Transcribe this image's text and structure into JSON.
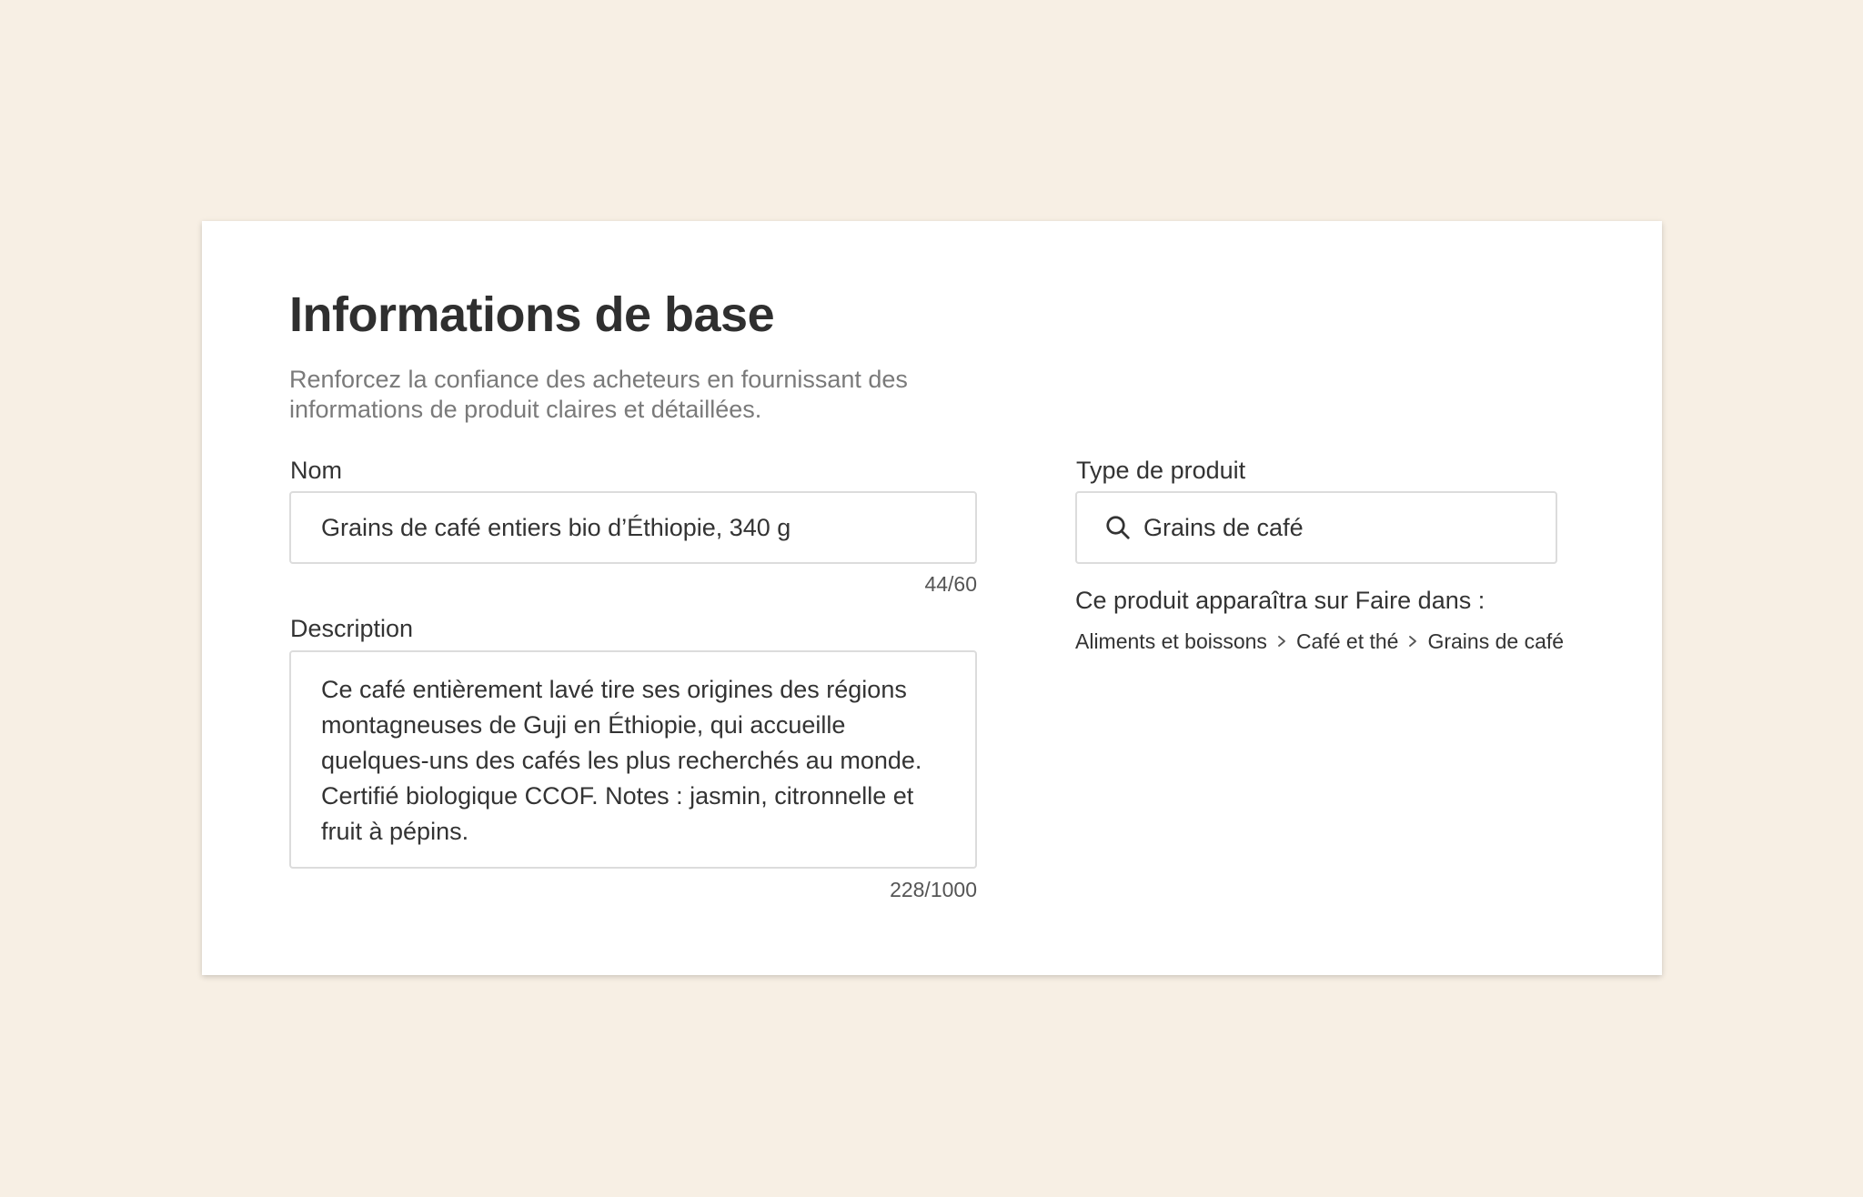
{
  "section": {
    "title": "Informations de base",
    "subtitle": "Renforcez la confiance des acheteurs en fournissant des informations de produit claires et détaillées."
  },
  "name_field": {
    "label": "Nom",
    "value": "Grains de café entiers bio d’Éthiopie, 340 g",
    "counter": "44/60"
  },
  "description_field": {
    "label": "Description",
    "value": "Ce café entièrement lavé tire ses origines des régions montagneuses de Guji en Éthiopie, qui accueille quelques-uns des cafés les plus recherchés au monde. Certifié biologique CCOF. Notes : jasmin, citronnelle et fruit à pépins.",
    "counter": "228/1000"
  },
  "product_type": {
    "label": "Type de produit",
    "value": "Grains de café",
    "icon": "search-icon",
    "appear_text": "Ce produit apparaîtra sur Faire dans :",
    "breadcrumb": [
      "Aliments et boissons",
      "Café et thé",
      "Grains de café"
    ],
    "separator_icon": "chevron-right-icon"
  },
  "colors": {
    "page_background": "#f7efe4",
    "card_background": "#ffffff",
    "border": "#dcdcdc",
    "text": "#333333",
    "muted_text": "#7a7a7a"
  }
}
